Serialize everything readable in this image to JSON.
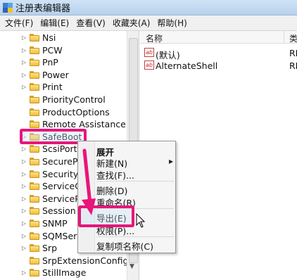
{
  "window": {
    "title": "注册表编辑器"
  },
  "menubar": {
    "items": [
      "文件(F)",
      "编辑(E)",
      "查看(V)",
      "收藏夹(A)",
      "帮助(H)"
    ]
  },
  "tree": {
    "items": [
      {
        "label": "Nsi",
        "expandable": true
      },
      {
        "label": "PCW",
        "expandable": true
      },
      {
        "label": "PnP",
        "expandable": true
      },
      {
        "label": "Power",
        "expandable": true
      },
      {
        "label": "Print",
        "expandable": true
      },
      {
        "label": "PriorityControl",
        "expandable": false
      },
      {
        "label": "ProductOptions",
        "expandable": false
      },
      {
        "label": "Remote Assistance",
        "expandable": false
      },
      {
        "label": "SafeBoot",
        "expandable": true,
        "selected": true
      },
      {
        "label": "ScsiPort",
        "expandable": true
      },
      {
        "label": "SecurePip",
        "expandable": true
      },
      {
        "label": "SecurityP",
        "expandable": true
      },
      {
        "label": "ServiceGr",
        "expandable": true
      },
      {
        "label": "ServicePr",
        "expandable": true
      },
      {
        "label": "Session M",
        "expandable": true
      },
      {
        "label": "SNMP",
        "expandable": true
      },
      {
        "label": "SQMServ",
        "expandable": true
      },
      {
        "label": "Srp",
        "expandable": true
      },
      {
        "label": "SrpExtensionConfig",
        "expandable": false
      },
      {
        "label": "StillImage",
        "expandable": true
      }
    ]
  },
  "list": {
    "columns": {
      "name": "名称",
      "type": "类"
    },
    "rows": [
      {
        "name": "(默认)",
        "type": "RE"
      },
      {
        "name": "AlternateShell",
        "type": "RE"
      }
    ]
  },
  "context_menu": {
    "items": [
      {
        "label": "展开",
        "bold": true
      },
      {
        "label": "新建(N)",
        "submenu": true
      },
      {
        "label": "查找(F)..."
      },
      {
        "label": "删除(D)"
      },
      {
        "label": "重命名(R)"
      },
      {
        "label": "导出(E)",
        "highlighted": true
      },
      {
        "label": "权限(P)..."
      },
      {
        "label": "复制项名称(C)"
      }
    ]
  },
  "colors": {
    "highlight_border": "#e8157a",
    "titlebar": "#cfe3f6"
  }
}
